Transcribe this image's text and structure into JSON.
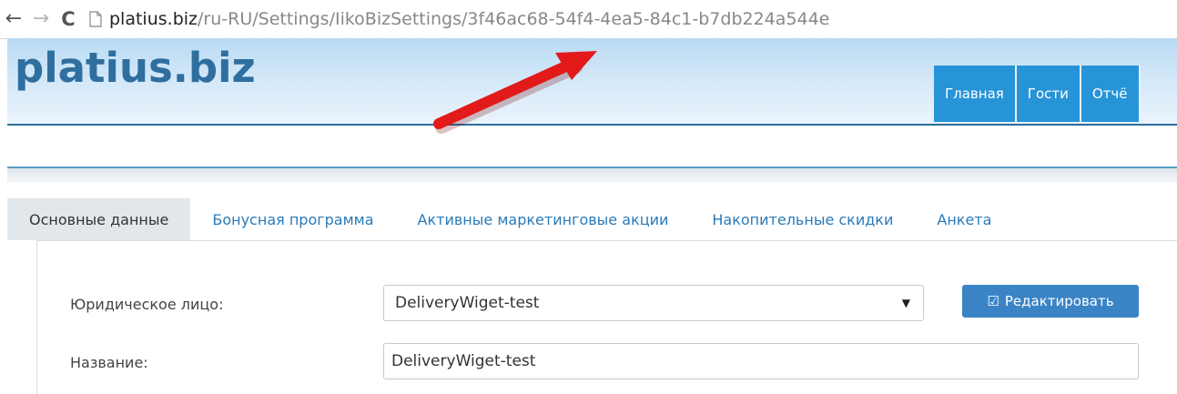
{
  "browser": {
    "back_icon": "←",
    "forward_icon": "→",
    "reload_icon": "C",
    "url_host": "platius.biz",
    "url_path": "/ru-RU/Settings/IikoBizSettings/3f46ac68-54f4-4ea5-84c1-b7db224a544e"
  },
  "header": {
    "logo": "platius.biz",
    "nav": [
      "Главная",
      "Гости",
      "Отчё"
    ]
  },
  "tabs": [
    {
      "label": "Основные данные",
      "active": true
    },
    {
      "label": "Бонусная программа",
      "active": false
    },
    {
      "label": "Активные маркетинговые акции",
      "active": false
    },
    {
      "label": "Накопительные скидки",
      "active": false
    },
    {
      "label": "Анкета",
      "active": false
    }
  ],
  "form": {
    "legal_entity_label": "Юридическое лицо:",
    "legal_entity_value": "DeliveryWiget-test",
    "caret": "▼",
    "edit_icon": "☑",
    "edit_label": "Редактировать",
    "name_label": "Название:",
    "name_value": "DeliveryWiget-test"
  },
  "colors": {
    "accent": "#2894d8",
    "logo": "#2f6f9f",
    "link": "#2a7ab8",
    "button": "#3a84c6",
    "arrow": "#e21a1a"
  }
}
